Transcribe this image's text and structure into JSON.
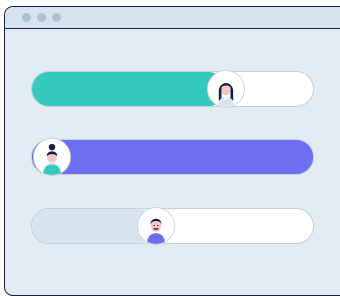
{
  "colors": {
    "track_bg": "#ffffff",
    "track_bg_alt": "#d6e4ed",
    "teal": "#35c8bd",
    "purple": "#6d6ff0",
    "frame": "#13214a"
  },
  "window": {
    "controls": [
      "close",
      "minimize",
      "maximize"
    ]
  },
  "bars": [
    {
      "id": "user-1",
      "progress": 0.69,
      "fill_color": "#35c8bd",
      "track_color": "#ffffff",
      "avatar": "woman-long-hair-icon"
    },
    {
      "id": "user-2",
      "progress": 0.07,
      "fill_color": "#6d6ff0",
      "track_color": "#6d6ff0",
      "avatar": "woman-bun-hair-icon"
    },
    {
      "id": "user-3",
      "progress": 0.44,
      "fill_color": "#d6e4ed",
      "track_color": "#ffffff",
      "avatar": "man-mustache-icon"
    }
  ]
}
